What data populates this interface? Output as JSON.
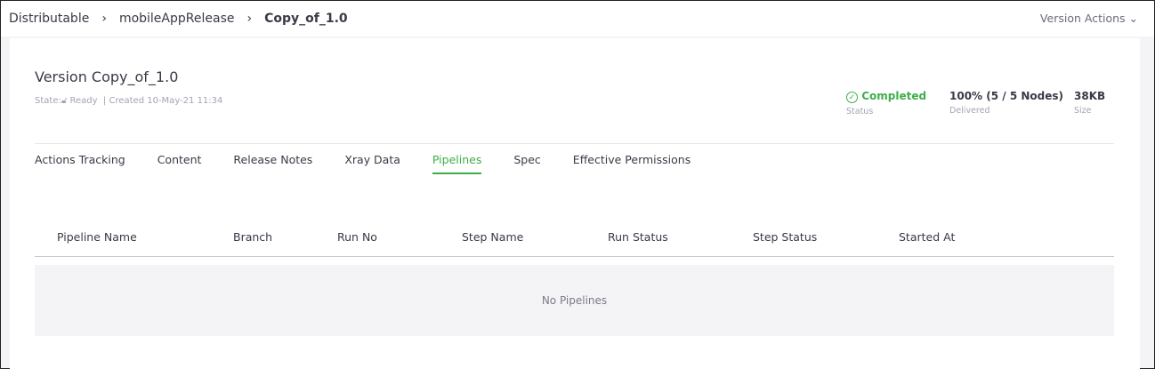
{
  "breadcrumb": [
    "Distributable",
    "mobileAppRelease",
    "Copy_of_1.0"
  ],
  "version_actions": "Version Actions",
  "version": {
    "title": "Version Copy_of_1.0",
    "state_label": "State:",
    "state": "Ready",
    "created": "| Created 10-May-21 11:34"
  },
  "stats": {
    "status_value": "Completed",
    "status_label": "Status",
    "delivered_value": "100% (5 / 5 Nodes)",
    "delivered_label": "Delivered",
    "size_value": "38KB",
    "size_label": "Size"
  },
  "tabs": [
    "Actions Tracking",
    "Content",
    "Release Notes",
    "Xray Data",
    "Pipelines",
    "Spec",
    "Effective Permissions"
  ],
  "active_tab": "Pipelines",
  "columns": [
    "Pipeline Name",
    "Branch",
    "Run No",
    "Step Name",
    "Run Status",
    "Step Status",
    "Started At"
  ],
  "empty_text": "No Pipelines"
}
